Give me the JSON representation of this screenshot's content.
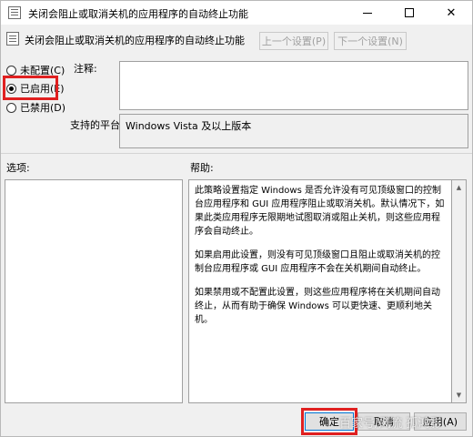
{
  "window": {
    "title": "关闭会阻止或取消关机的应用程序的自动终止功能",
    "icon": "policy-doc-icon"
  },
  "header": {
    "title": "关闭会阻止或取消关机的应用程序的自动终止功能",
    "prev_label": "上一个设置(P)",
    "next_label": "下一个设置(N)"
  },
  "state": {
    "options": [
      {
        "label": "未配置(C)",
        "checked": false
      },
      {
        "label": "已启用(E)",
        "checked": true
      },
      {
        "label": "已禁用(D)",
        "checked": false
      }
    ]
  },
  "labels": {
    "comment": "注释:",
    "platform": "支持的平台:",
    "options": "选项:",
    "help": "帮助:"
  },
  "comment_value": "",
  "platform_value": "Windows Vista 及以上版本",
  "help": {
    "paragraphs": [
      "此策略设置指定 Windows 是否允许没有可见顶级窗口的控制台应用程序和 GUI 应用程序阻止或取消关机。默认情况下，如果此类应用程序无限期地试图取消或阻止关机，则这些应用程序会自动终止。",
      "如果启用此设置，则没有可见顶级窗口且阻止或取消关机的控制台应用程序或 GUI 应用程序不会在关机期间自动终止。",
      "如果禁用或不配置此设置，则这些应用程序将在关机期间自动终止，从而有助于确保 Windows 可以更快速、更顺利地关机。"
    ]
  },
  "buttons": {
    "ok": "确定",
    "cancel": "取消",
    "apply": "应用(A)"
  },
  "watermark": "百家号/风流 孤鸿影"
}
